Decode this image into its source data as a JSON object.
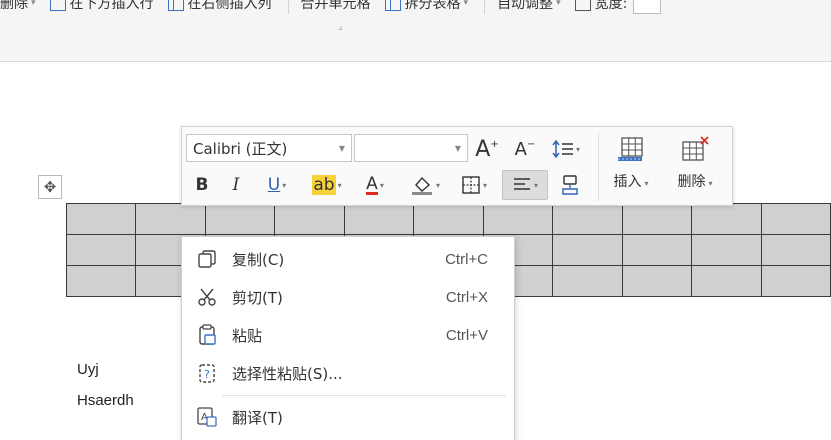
{
  "ribbon": {
    "delete_label": "删除",
    "insert_below_label": "在下方插入行",
    "insert_right_label": "在右侧插入列",
    "merge_cells_label": "合并单元格",
    "split_table_label": "拆分表格",
    "auto_fit_label": "自动调整",
    "width_label": "宽度:"
  },
  "mini_toolbar": {
    "font_name": "Calibri (正文)",
    "font_size": "",
    "insert_label": "插入",
    "delete_label": "删除",
    "grow_font": "A",
    "shrink_font": "A",
    "bold": "B",
    "italic": "I",
    "underline": "U",
    "highlight": "ab",
    "font_color": "A",
    "highlight_color": "#f7d13c",
    "font_color_value": "#e02b20"
  },
  "context_menu": {
    "items": [
      {
        "label": "复制(C)",
        "shortcut": "Ctrl+C",
        "icon": "copy-icon"
      },
      {
        "label": "剪切(T)",
        "shortcut": "Ctrl+X",
        "icon": "cut-icon"
      },
      {
        "label": "粘贴",
        "shortcut": "Ctrl+V",
        "icon": "paste-icon"
      },
      {
        "label": "选择性粘贴(S)...",
        "shortcut": "",
        "icon": "paste-special-icon"
      },
      {
        "label": "翻译(T)",
        "shortcut": "",
        "icon": "translate-icon"
      }
    ]
  },
  "document": {
    "lines": [
      "Uyj",
      "Hsaerdh"
    ],
    "table": {
      "rows": 3,
      "cols": 11
    }
  },
  "colors": {
    "ribbon_bg": "#f5f5f5",
    "table_cell_bg": "#d0d0d0",
    "accent_blue": "#3b72c5",
    "delete_red": "#e02b20"
  }
}
